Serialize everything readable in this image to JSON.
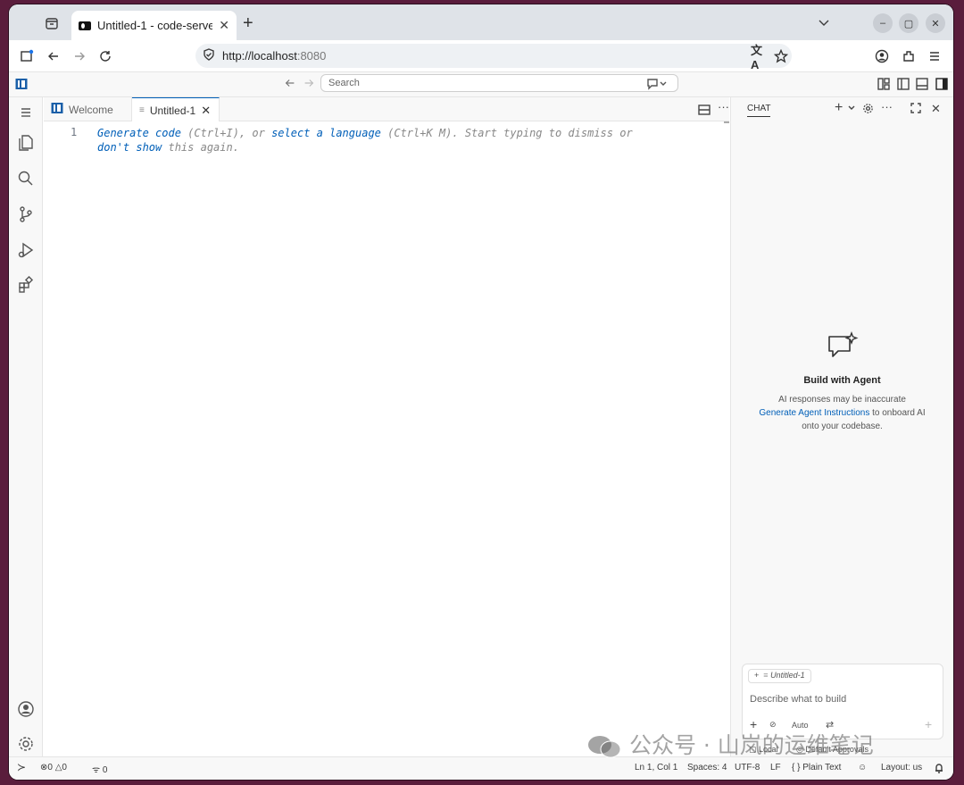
{
  "browser": {
    "tab_title": "Untitled-1 - code-server",
    "url_host": "http://localhost",
    "url_port": ":8080"
  },
  "vscode": {
    "search_placeholder": "Search",
    "tabs": [
      {
        "label": "Welcome"
      },
      {
        "label": "Untitled-1"
      }
    ],
    "editor": {
      "line_number": "1",
      "hint": {
        "generate_code": "Generate code",
        "shortcut1": " (Ctrl+I), or ",
        "select_a_language": "select a language",
        "shortcut2": " (Ctrl+K M). Start typing to dismiss or ",
        "dont_show": "don't show",
        "tail": " this again."
      }
    },
    "chat": {
      "title": "CHAT",
      "empty_heading": "Build with Agent",
      "empty_line1": "AI responses may be inaccurate",
      "empty_link": "Generate Agent Instructions",
      "empty_line2": " to onboard AI",
      "empty_line3": "onto your codebase.",
      "context_chip": "Untitled-1",
      "input_placeholder": "Describe what to build",
      "mode": "Auto",
      "footer_local": "Local",
      "footer_approvals": "Default Approvals"
    },
    "statusbar": {
      "errors": "0",
      "warnings": "0",
      "ports": "0",
      "position": "Ln 1, Col 1",
      "spaces": "Spaces: 4",
      "encoding": "UTF-8",
      "eol": "LF",
      "language": "Plain Text",
      "layout": "Layout: us"
    }
  },
  "watermark": "公众号 · 山岚的运维笔记"
}
